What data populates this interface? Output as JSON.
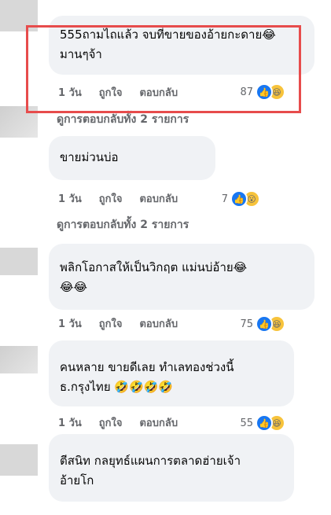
{
  "comments": [
    {
      "text": "555ถามไถแล้ว จบที่ขายของอ้ายกะดาย😂 มานๆจ้า",
      "actions": [
        "1 วัน",
        "ถูกใจ",
        "ตอบกลับ"
      ],
      "reactions": "87",
      "replies": "ดูการตอบกลับทั้ง 2 รายการ"
    },
    {
      "text": "ขายม่วนบ่อ",
      "actions": [
        "1 วัน",
        "ถูกใจ",
        "ตอบกลับ"
      ],
      "reactions": "7",
      "replies": "ดูการตอบกลับทั้ง 2 รายการ"
    },
    {
      "text": "พลิกโอกาสให้เป็นวิกฤต แม่นบ่อ้าย😂\n😂😂",
      "actions": [
        "1 วัน",
        "ถูกใจ",
        "ตอบกลับ"
      ],
      "reactions": "75"
    },
    {
      "text": "คนหลาย ขายดีเลย ทำเลทองช่วงนี้\nธ.กรุงไทย 🤣🤣🤣🤣",
      "actions": [
        "1 วัน",
        "ถูกใจ",
        "ตอบกลับ"
      ],
      "reactions": "55"
    },
    {
      "text": "ตีสนิท กลยุทธ์แผนการตลาดฮ่ายเจ้า\nอ้ายโก"
    }
  ]
}
